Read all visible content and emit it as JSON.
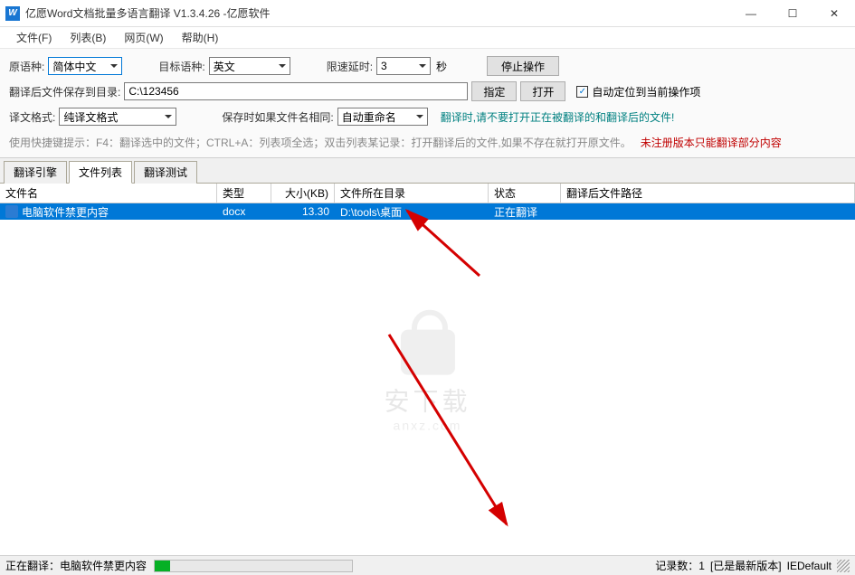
{
  "window": {
    "title": "亿愿Word文档批量多语言翻译 V1.3.4.26 -亿愿软件",
    "logo_text": "W"
  },
  "menu": {
    "file": "文件(F)",
    "list": "列表(B)",
    "web": "网页(W)",
    "help": "帮助(H)"
  },
  "toolbar": {
    "src_lang_label": "原语种:",
    "src_lang_value": "简体中文",
    "dst_lang_label": "目标语种:",
    "dst_lang_value": "英文",
    "delay_label": "限速延时:",
    "delay_value": "3",
    "delay_unit": "秒",
    "stop_btn": "停止操作",
    "save_dir_label": "翻译后文件保存到目录:",
    "save_dir_value": "C:\\123456",
    "assign_btn": "指定",
    "open_btn": "打开",
    "auto_locate_label": "自动定位到当前操作项",
    "format_label": "译文格式:",
    "format_value": "纯译文格式",
    "samefile_label": "保存时如果文件名相同:",
    "samefile_value": "自动重命名",
    "warning_teal": "翻译时,请不要打开正在被翻译的和翻译后的文件!",
    "shortcut_hint": "使用快捷键提示：F4：翻译选中的文件；CTRL+A：列表项全选；双击列表某记录：打开翻译后的文件,如果不存在就打开原文件。",
    "unregistered": "未注册版本只能翻译部分内容"
  },
  "tabs": {
    "engine": "翻译引擎",
    "filelist": "文件列表",
    "test": "翻译测试"
  },
  "table": {
    "headers": {
      "name": "文件名",
      "type": "类型",
      "size": "大小(KB)",
      "dir": "文件所在目录",
      "status": "状态",
      "out": "翻译后文件路径"
    },
    "rows": [
      {
        "name": "电脑软件禁更内容",
        "type": "docx",
        "size": "13.30",
        "dir": "D:\\tools\\桌面",
        "status": "正在翻译",
        "out": ""
      }
    ]
  },
  "watermark": {
    "line1": "安下载",
    "line2": "anxz.com"
  },
  "status": {
    "left": "正在翻译：电脑软件禁更内容",
    "records": "记录数：1",
    "version": "[已是最新版本]",
    "browser": "IEDefault"
  }
}
